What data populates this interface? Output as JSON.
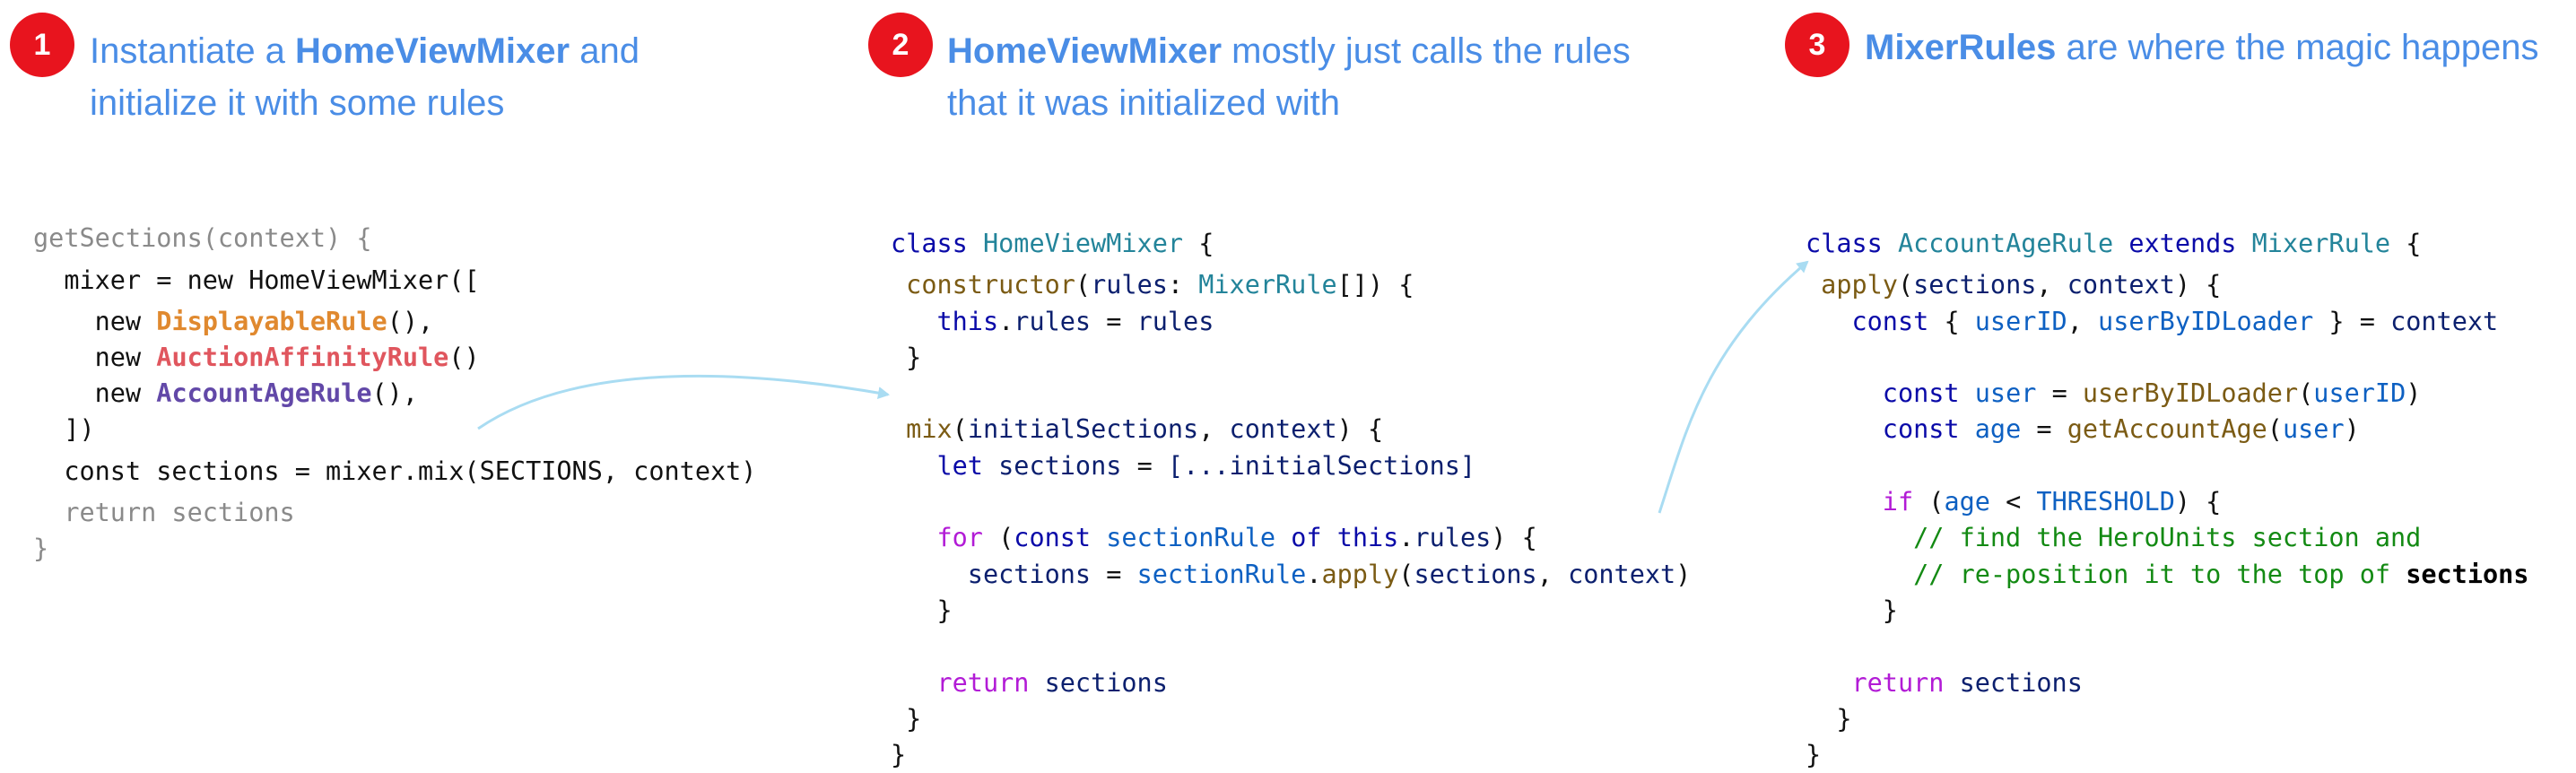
{
  "steps": [
    {
      "number": "1",
      "title_bold": "HomeViewMixer",
      "title_pre": "Instantiate a ",
      "title_post": " and",
      "title_line2": "initialize it with some rules"
    },
    {
      "number": "2",
      "title_bold": "HomeViewMixer",
      "title_post": " mostly just calls the rules",
      "title_line2": "that it was initialized with"
    },
    {
      "number": "3",
      "title_bold": "MixerRules",
      "title_post": " are where the magic happens"
    }
  ],
  "code1": {
    "l1": "getSections(context) {",
    "l2": "  mixer = new HomeViewMixer([",
    "l3_pre": "    new ",
    "l3_rule": "DisplayableRule",
    "l3_post": "(),",
    "l4_pre": "    new ",
    "l4_rule": "AuctionAffinityRule",
    "l4_post": "()",
    "l5_pre": "    new ",
    "l5_rule": "AccountAgeRule",
    "l5_post": "(),",
    "l6": "  ])",
    "l7": "  const sections = mixer.mix(SECTIONS, context)",
    "l8": "  return sections",
    "l9": "}"
  },
  "code2": {
    "class_kw": "class",
    "class_name": "HomeViewMixer",
    "brace_open": " {",
    "ctor": "constructor",
    "rules_param": "rules",
    "mixer_rule_type": "MixerRule",
    "this_kw": "this",
    "rules_prop": "rules",
    "rules_val": "rules",
    "mix_fn": "mix",
    "initial_sections": "initialSections",
    "context": "context",
    "let_kw": "let",
    "sections": "sections",
    "spread": "[...initialSections]",
    "for_kw": "for",
    "const_kw": "const",
    "section_rule": "sectionRule",
    "of_kw": "of",
    "apply_fn": "apply",
    "return_kw": "return",
    "close": "}"
  },
  "code3": {
    "class_kw": "class",
    "class_name": "AccountAgeRule",
    "extends_kw": "extends",
    "parent": "MixerRule",
    "apply_fn": "apply",
    "sections": "sections",
    "context": "context",
    "const_kw": "const",
    "user_id": "userID",
    "loader": "userByIDLoader",
    "user": "user",
    "age": "age",
    "get_age": "getAccountAge",
    "if_kw": "if",
    "threshold": "THRESHOLD",
    "comment1": "// find the HeroUnits section and",
    "comment2": "// re-position it to the top of ",
    "comment2_bold": "sections",
    "return_kw": "return",
    "close": "}"
  },
  "colors": {
    "badge": "#e8141e",
    "heading": "#4a8de6",
    "arrow": "#a9dcf2"
  }
}
